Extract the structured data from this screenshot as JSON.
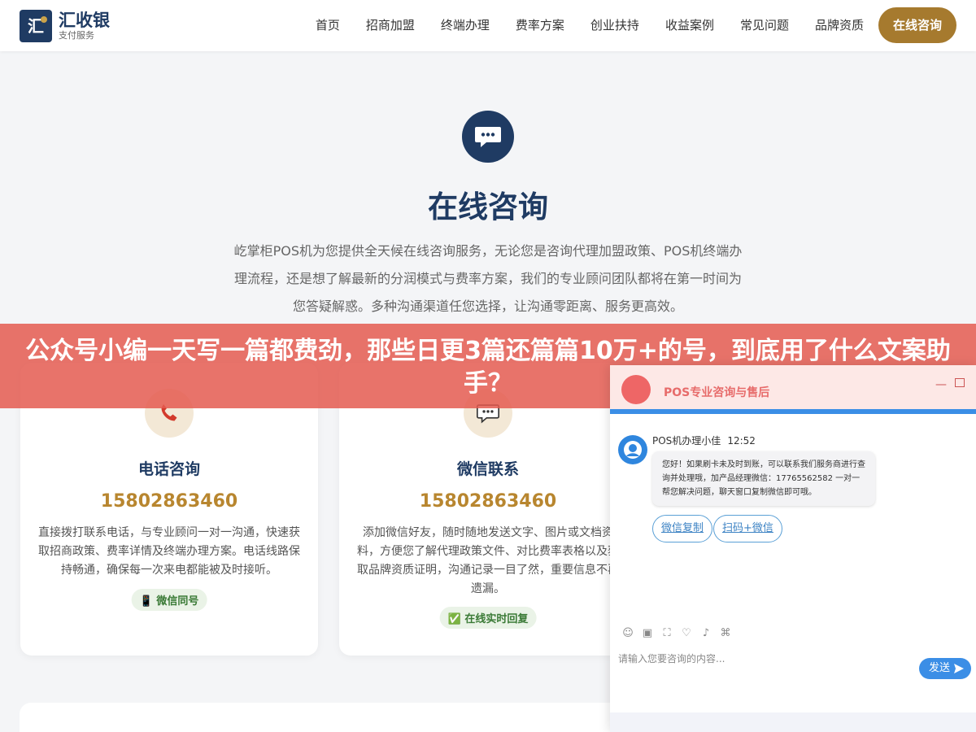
{
  "header": {
    "logo_glyph": "汇",
    "logo_name": "汇收银",
    "logo_sub": "支付服务",
    "nav": [
      "首页",
      "招商加盟",
      "终端办理",
      "费率方案",
      "创业扶持",
      "收益案例",
      "常见问题",
      "品牌资质"
    ],
    "cta": "在线咨询"
  },
  "hero": {
    "title": "在线咨询",
    "description": "屹掌柜POS机为您提供全天候在线咨询服务，无论您是咨询代理加盟政策、POS机终端办理流程，还是想了解最新的分润模式与费率方案，我们的专业顾问团队都将在第一时间为您答疑解惑。多种沟通渠道任您选择，让沟通零距离、服务更高效。"
  },
  "cards": [
    {
      "icon": "phone-icon",
      "title": "电话咨询",
      "phone": "15802863460",
      "description": "直接拨打联系电话，与专业顾问一对一沟通，快速获取招商政策、费率详情及终端办理方案。电话线路保持畅通，确保每一次来电都能被及时接听。",
      "tag": "📱 微信同号"
    },
    {
      "icon": "chat-icon",
      "title": "微信联系",
      "phone": "15802863460",
      "description": "添加微信好友，随时随地发送文字、图片或文档资料，方便您了解代理政策文件、对比费率表格以及获取品牌资质证明，沟通记录一目了然，重要信息不再遗漏。",
      "tag": "✅ 在线实时回复"
    }
  ],
  "banner": {
    "text": "公众号小编一天写一篇都费劲，那些日更3篇还篇篇10万+的号，到底用了什么文案助手？"
  },
  "chat": {
    "title": "POS专业咨询与售后",
    "minimize": "—",
    "agent_name": "POS机办理小佳",
    "time": "12:52",
    "message": "您好！如果刷卡未及时到账，可以联系我们服务商进行查询并处理哦，加产品经理微信：17765562582 一对一帮您解决问题，聊天窗口复制微信即可哦。",
    "chips": [
      "微信复制",
      "扫码+微信"
    ],
    "tools": [
      "☺",
      "▣",
      "⛶",
      "♡",
      "♪",
      "⌘"
    ],
    "input_placeholder": "请输入您要咨询的内容...",
    "send": "发送"
  },
  "colors": {
    "brand": "#1f3b63",
    "gold": "#a67a2e",
    "banner": "#e45a50",
    "chat_blue": "#3b8ee6"
  }
}
